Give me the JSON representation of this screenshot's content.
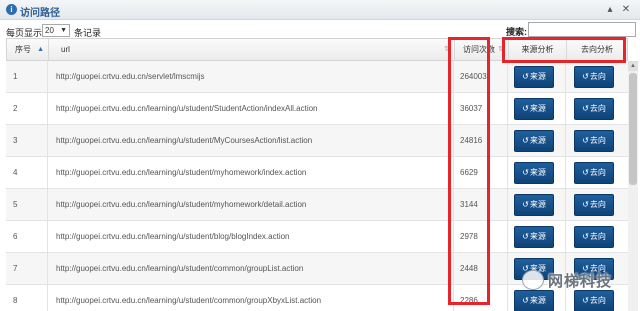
{
  "window": {
    "title": "访问路径",
    "info_icon": "info-icon",
    "collapse_icon": "chevron-up-icon",
    "close_icon": "close-icon"
  },
  "toolbar": {
    "per_page_prefix": "每页显示",
    "per_page_value": "20",
    "per_page_suffix": "条记录",
    "search_label": "搜索:",
    "search_value": ""
  },
  "table": {
    "headers": {
      "index": "序号",
      "url": "url",
      "visits": "访问次数",
      "source": "来源分析",
      "dest": "去向分析"
    },
    "source_button_label": "来源",
    "dest_button_label": "去向",
    "rows": [
      {
        "index": "1",
        "url": "http://guopei.crtvu.edu.cn/servlet/lmscmijs",
        "visits": "264003"
      },
      {
        "index": "2",
        "url": "http://guopei.crtvu.edu.cn/learning/u/student/StudentAction/indexAll.action",
        "visits": "36037"
      },
      {
        "index": "3",
        "url": "http://guopei.crtvu.edu.cn/learning/u/student/MyCoursesAction/list.action",
        "visits": "24816"
      },
      {
        "index": "4",
        "url": "http://guopei.crtvu.edu.cn/learning/u/student/myhomework/index.action",
        "visits": "6629"
      },
      {
        "index": "5",
        "url": "http://guopei.crtvu.edu.cn/learning/u/student/myhomework/detail.action",
        "visits": "3144"
      },
      {
        "index": "6",
        "url": "http://guopei.crtvu.edu.cn/learning/u/student/blog/blogIndex.action",
        "visits": "2978"
      },
      {
        "index": "7",
        "url": "http://guopei.crtvu.edu.cn/learning/u/student/common/groupList.action",
        "visits": "2448"
      },
      {
        "index": "8",
        "url": "http://guopei.crtvu.edu.cn/learning/u/student/common/groupXbyxList.action",
        "visits": "2286"
      }
    ]
  },
  "watermark": {
    "text": "网梯科技"
  },
  "colors": {
    "accent": "#0f4377",
    "annotation": "#e8232a"
  }
}
